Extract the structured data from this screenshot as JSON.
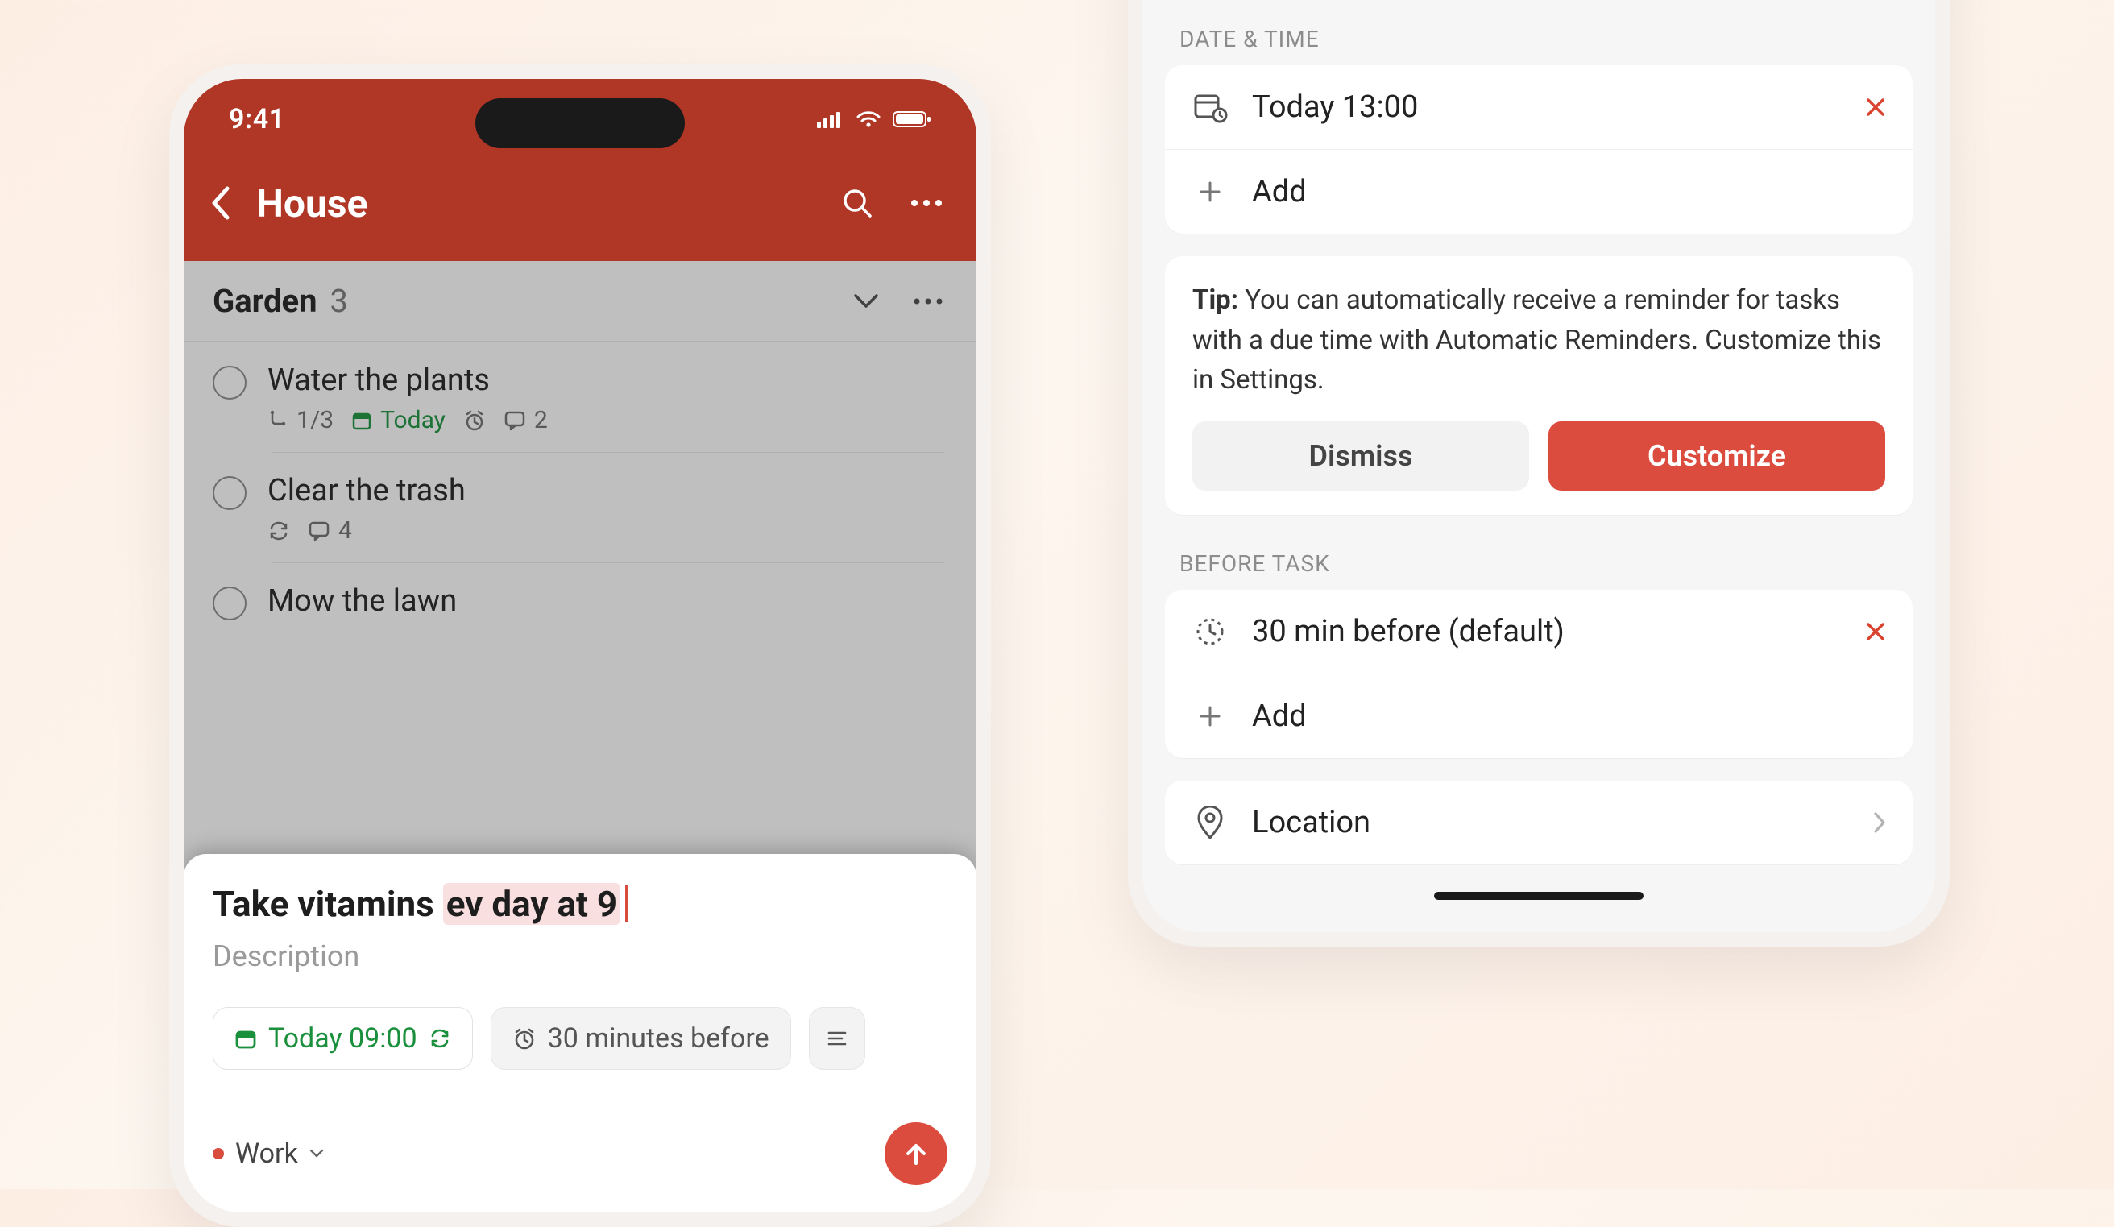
{
  "left": {
    "status_time": "9:41",
    "nav_title": "House",
    "section": {
      "name": "Garden",
      "count": "3"
    },
    "tasks": [
      {
        "name": "Water the plants",
        "sub_count": "1/3",
        "due": "Today",
        "comments": "2",
        "has_alarm": true,
        "has_recur": false
      },
      {
        "name": "Clear the trash",
        "comments": "4",
        "has_recur": true
      },
      {
        "name": "Mow the lawn"
      }
    ],
    "sheet": {
      "title_prefix": "Take vitamins ",
      "title_highlight": "ev day at 9",
      "description_placeholder": "Description",
      "chip_due": "Today 09:00",
      "chip_reminder": "30 minutes before",
      "project": "Work"
    }
  },
  "right": {
    "section_datetime": "DATE & TIME",
    "datetime_value": "Today 13:00",
    "add_label": "Add",
    "tip_bold": "Tip:",
    "tip_text": " You can automatically receive a reminder for tasks with a due time with Automatic Reminders. Customize this in Settings.",
    "dismiss": "Dismiss",
    "customize": "Customize",
    "section_before": "BEFORE TASK",
    "before_value": "30 min before (default)",
    "location": "Location"
  }
}
